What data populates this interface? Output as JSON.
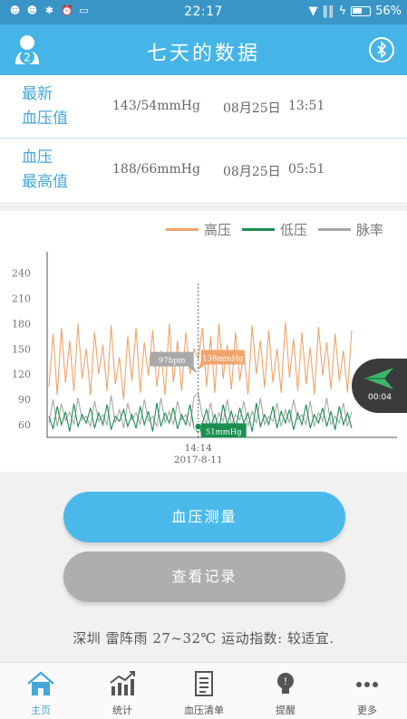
{
  "status_bar": {
    "time": "22:17",
    "battery": "56%"
  },
  "header": {
    "title": "七天的数据",
    "avatar_badge": "2"
  },
  "rows": [
    {
      "label_line1": "最新",
      "label_line2": "血压值",
      "value": "143/54mmHg",
      "date": "08月25日",
      "time": "13:51"
    },
    {
      "label_line1": "血压",
      "label_line2": "最高值",
      "value": "188/66mmHg",
      "date": "08月25日",
      "time": "05:51"
    }
  ],
  "legend": {
    "high": "高压",
    "low": "低压",
    "pulse": "脉率"
  },
  "colors": {
    "high": "#f0a46b",
    "low": "#1b8f50",
    "pulse": "#a8a8a8",
    "accent": "#46b4e6"
  },
  "chart_data": {
    "type": "line",
    "y_ticks": [
      "240",
      "210",
      "180",
      "150",
      "120",
      "90",
      "60"
    ],
    "ylim": [
      45,
      260
    ],
    "cursor_time": "14:14",
    "cursor_date": "2017-8-11",
    "tooltip_high": "138mmHg",
    "tooltip_low": "51mmHg",
    "tooltip_pulse": "97bpm",
    "series": [
      {
        "name": "高压",
        "values": [
          105,
          168,
          95,
          175,
          110,
          160,
          100,
          180,
          115,
          150,
          95,
          170,
          120,
          155,
          100,
          178,
          108,
          140,
          90,
          165,
          112,
          175,
          98,
          158,
          118,
          172,
          105,
          148,
          95,
          180,
          110,
          160,
          100,
          170,
          120,
          150,
          138,
          175,
          105,
          165,
          98,
          180,
          115,
          155,
          102,
          170,
          112,
          148,
          96,
          178,
          120,
          160,
          104,
          172,
          110,
          150,
          98,
          182,
          116,
          162,
          100,
          170,
          108,
          152,
          96,
          176,
          118,
          158,
          102,
          168,
          112,
          148,
          98,
          172
        ]
      },
      {
        "name": "低压",
        "values": [
          70,
          55,
          82,
          60,
          75,
          52,
          85,
          58,
          72,
          62,
          80,
          56,
          74,
          60,
          84,
          54,
          70,
          64,
          78,
          58,
          72,
          56,
          82,
          60,
          76,
          52,
          86,
          58,
          74,
          62,
          80,
          55,
          72,
          60,
          84,
          56,
          51,
          62,
          78,
          58,
          72,
          54,
          84,
          60,
          76,
          56,
          80,
          62,
          74,
          52,
          86,
          58,
          72,
          60,
          82,
          56,
          76,
          62,
          78,
          54,
          74,
          60,
          84,
          56,
          72,
          62,
          80,
          58,
          76,
          54,
          82,
          60,
          74,
          56
        ]
      },
      {
        "name": "脉率",
        "values": [
          62,
          90,
          58,
          85,
          65,
          75,
          60,
          92,
          66,
          70,
          58,
          88,
          64,
          72,
          60,
          95,
          62,
          78,
          56,
          86,
          66,
          74,
          60,
          90,
          64,
          70,
          58,
          92,
          62,
          76,
          60,
          88,
          66,
          72,
          58,
          94,
          97,
          70,
          62,
          86,
          58,
          74,
          64,
          90,
          60,
          72,
          66,
          88,
          58,
          76,
          62,
          92,
          60,
          70,
          64,
          86,
          58,
          78,
          62,
          90,
          66,
          72,
          60,
          88,
          58,
          74,
          64,
          92,
          60,
          70,
          62,
          86,
          58,
          76
        ]
      }
    ]
  },
  "play": {
    "time": "00:04"
  },
  "buttons": {
    "measure": "血压测量",
    "records": "查看记录"
  },
  "weather": {
    "text": "深圳 雷阵雨 27~32℃  运动指数: 较适宜."
  },
  "nav": [
    {
      "label": "主页",
      "icon": "home-icon",
      "active": true
    },
    {
      "label": "统计",
      "icon": "chart-icon",
      "active": false
    },
    {
      "label": "血压清单",
      "icon": "list-icon",
      "active": false
    },
    {
      "label": "提醒",
      "icon": "bulb-icon",
      "active": false
    },
    {
      "label": "更多",
      "icon": "more-icon",
      "active": false
    }
  ]
}
